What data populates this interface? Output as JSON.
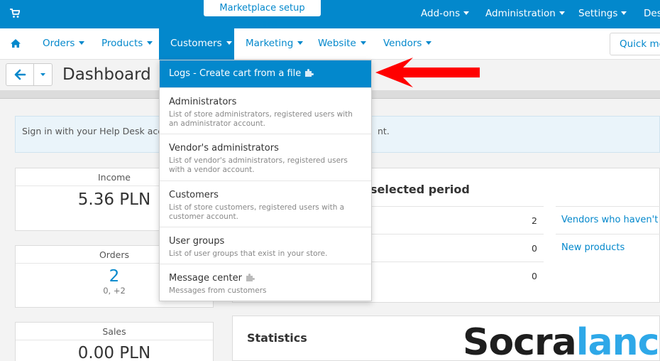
{
  "topbar": {
    "wizard_label": "Marketplace setup wizard",
    "menu": [
      {
        "label": "Add-ons"
      },
      {
        "label": "Administration"
      },
      {
        "label": "Settings"
      },
      {
        "label": "Des"
      }
    ]
  },
  "mainnav": {
    "items": [
      {
        "label": "Orders"
      },
      {
        "label": "Products"
      },
      {
        "label": "Customers"
      },
      {
        "label": "Marketing"
      },
      {
        "label": "Website"
      },
      {
        "label": "Vendors"
      }
    ],
    "quick_menu_label": "Quick me"
  },
  "page": {
    "title": "Dashboard"
  },
  "notice": {
    "text_left": "Sign in with your Help Desk accou",
    "text_right": "nt."
  },
  "cards": {
    "income": {
      "label": "Income",
      "value": "5.36 PLN"
    },
    "orders": {
      "label": "Orders",
      "value": "2",
      "sub": "0, +2"
    },
    "sales": {
      "label": "Sales",
      "value": "0.00 PLN"
    }
  },
  "panel": {
    "title": "selected period",
    "values": [
      "2",
      "0",
      "0"
    ],
    "links": [
      "Vendors who haven't sig",
      "New products"
    ]
  },
  "statistics": {
    "title": "Statistics"
  },
  "dropdown": {
    "highlighted": "Logs - Create cart from a file",
    "items": [
      {
        "title": "Administrators",
        "desc": "List of store administrators, registered users with an administrator account."
      },
      {
        "title": "Vendor's administrators",
        "desc": "List of vendor's administrators, registered users with a vendor account."
      },
      {
        "title": "Customers",
        "desc": "List of store customers, registered users with a customer account."
      },
      {
        "title": "User groups",
        "desc": "List of user groups that exist in your store."
      },
      {
        "title": "Message center",
        "desc": "Messages from customers"
      }
    ]
  },
  "watermark": {
    "part1": "Socra",
    "part2": "lance"
  },
  "colors": {
    "primary": "#0388cc",
    "arrow": "#ff0000",
    "watermark_dark": "#1e1e1e",
    "watermark_blue": "#2ea8e8"
  },
  "icons": [
    "cart-icon",
    "home-icon",
    "back-arrow-icon",
    "caret-down-icon",
    "puzzle-icon",
    "pointer-arrow"
  ]
}
